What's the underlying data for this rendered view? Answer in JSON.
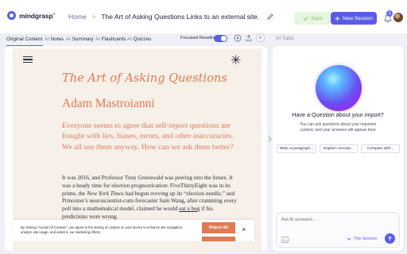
{
  "app": {
    "brand": "mindgrasp",
    "brand_mark": "®"
  },
  "header": {
    "home": "Home",
    "separator": ">",
    "title": "The Art of Asking Questions Links to an external site.",
    "save_label": "Save",
    "new_session_label": "New Session",
    "notification_count": "1"
  },
  "tabs": [
    {
      "prefix": "",
      "label": "Original Content"
    },
    {
      "prefix": "AI",
      "label": "Notes"
    },
    {
      "prefix": "AI",
      "label": "Summary"
    },
    {
      "prefix": "AI",
      "label": "Flashcards"
    },
    {
      "prefix": "AI",
      "label": "Quizzes"
    }
  ],
  "toolbar": {
    "focused_reading": "Focused Reading",
    "counter": "0"
  },
  "article": {
    "title": "The Art of Asking Questions",
    "author": "Adam Mastroianni",
    "lead": "Everyone seems to agree that self-report questions are fraught with lies, biases, errors, and other inaccuracies. We all use them anyway. How can we ask them better?",
    "body_1": "It was 2016, and Professor Tony Greenwald was peering into the future. It was a heady time for election prognostication: FiveThirtyEight was in its prime, the ",
    "body_italic": "New York Times",
    "body_2": " had begun revving up its “election needle,” and Princeton’s neuroscientist-cum-forecaster Sam Wang, after cramming every poll into a mathematical model, claimed he would ",
    "body_link": "eat a bug",
    "body_3": " if his predictions were wrong."
  },
  "cookie": {
    "text": "By clicking “Accept All Cookies”, you agree to the storing of cookies on your device to enhance site navigation, analyze site usage, and assist in our marketing efforts.",
    "reject_label": "Reject All",
    "close": "×"
  },
  "tutor": {
    "label": "AI Tutor",
    "question": "Have a Question about your import?",
    "subtext": "You can ask questions about your imported content, and your answers will appear here",
    "chips": [
      "Write a paragraph...",
      "Explain concept...",
      "Compare with..."
    ],
    "input_placeholder": "Ask AI assistant...",
    "scope_label": "This Session"
  },
  "colors": {
    "accent": "#5b5ce6",
    "article_accent": "#e07a55",
    "paper": "#f7f0e8",
    "save_bg": "#e6f6df"
  }
}
